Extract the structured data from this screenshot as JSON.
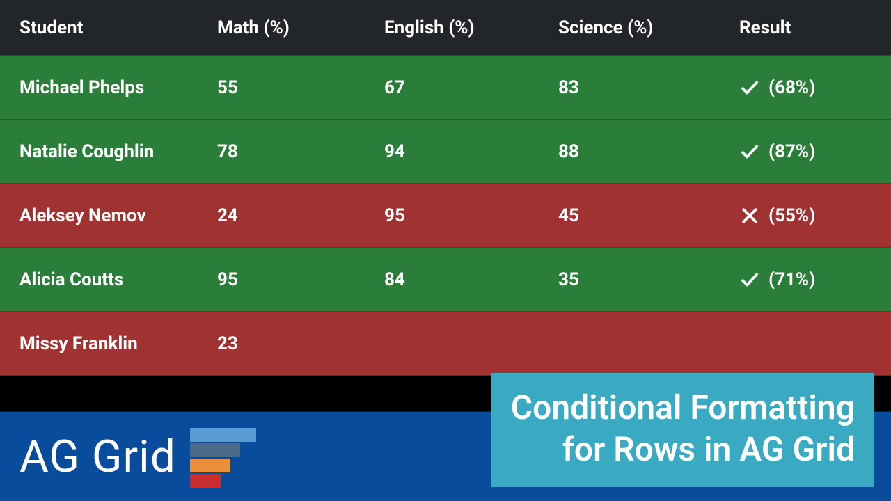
{
  "columns": {
    "student": "Student",
    "math": "Math (%)",
    "english": "English (%)",
    "science": "Science (%)",
    "result": "Result"
  },
  "rows": [
    {
      "student": "Michael Phelps",
      "math": "55",
      "english": "67",
      "science": "83",
      "status": "pass",
      "result_pct": "(68%)"
    },
    {
      "student": "Natalie Coughlin",
      "math": "78",
      "english": "94",
      "science": "88",
      "status": "pass",
      "result_pct": "(87%)"
    },
    {
      "student": "Aleksey Nemov",
      "math": "24",
      "english": "95",
      "science": "45",
      "status": "fail",
      "result_pct": "(55%)"
    },
    {
      "student": "Alicia Coutts",
      "math": "95",
      "english": "84",
      "science": "35",
      "status": "pass",
      "result_pct": "(71%)"
    },
    {
      "student": "Missy Franklin",
      "math": "23",
      "english": "",
      "science": "",
      "status": "fail",
      "result_pct": ""
    }
  ],
  "logo": {
    "text": "AG Grid"
  },
  "title": {
    "line1": "Conditional Formatting",
    "line2": "for Rows in AG Grid"
  },
  "colors": {
    "pass": "#2b7d3a",
    "fail": "#a13232",
    "header": "#222628",
    "footer": "#0a4c9c",
    "card": "#3aa9c2"
  }
}
